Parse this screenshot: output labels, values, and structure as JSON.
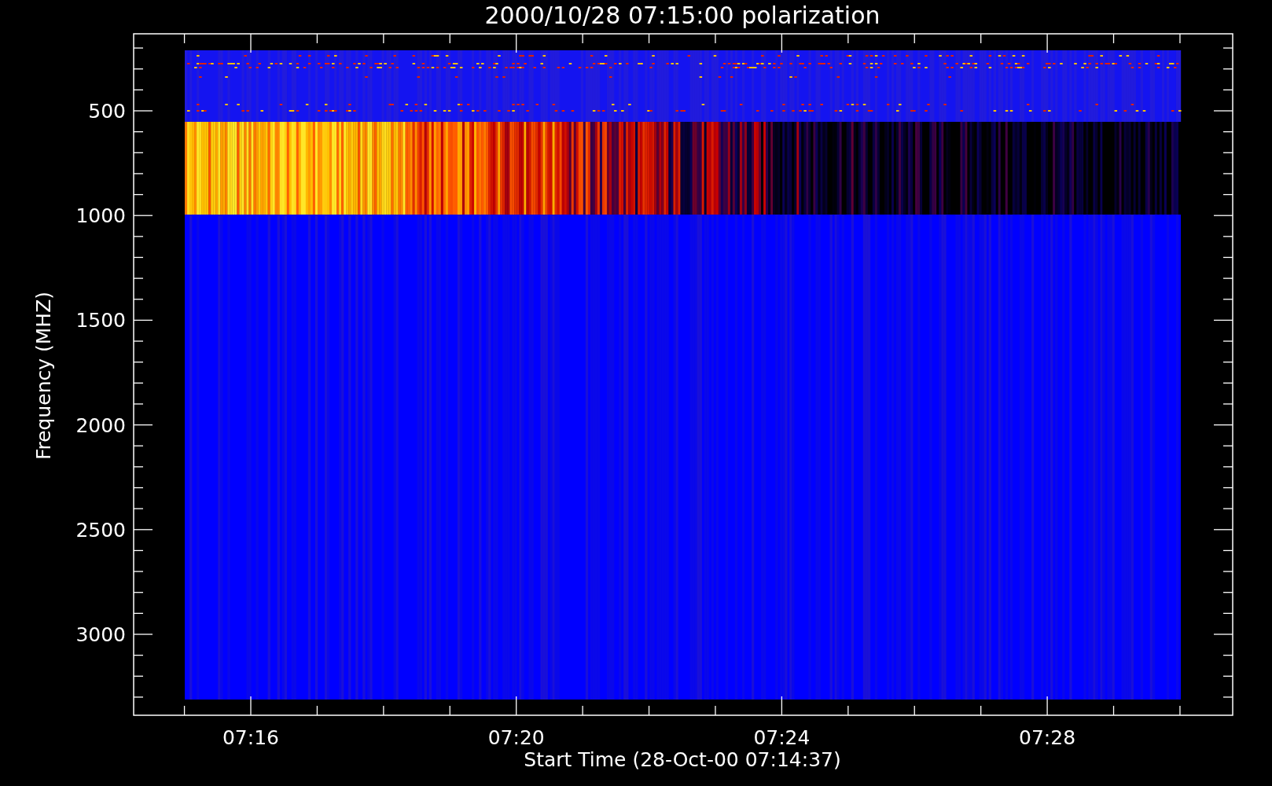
{
  "title": "2000/10/28 07:15:00 polarization",
  "y_axis": {
    "label": "Frequency (MHZ)",
    "ticks": [
      "500",
      "1000",
      "1500",
      "2000",
      "2500",
      "3000"
    ]
  },
  "x_axis": {
    "label": "Start Time (28-Oct-00 07:14:37)",
    "ticks": [
      "07:16",
      "07:20",
      "07:24",
      "07:28"
    ]
  }
}
